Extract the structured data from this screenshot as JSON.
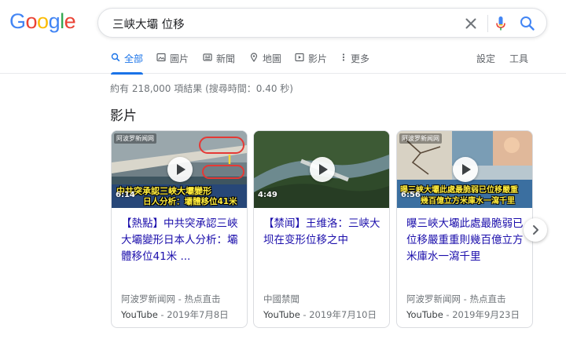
{
  "logo": {
    "letters": [
      "G",
      "o",
      "o",
      "g",
      "l",
      "e"
    ],
    "colors": [
      "#4285f4",
      "#ea4335",
      "#fbbc05",
      "#4285f4",
      "#34a853",
      "#ea4335"
    ]
  },
  "search": {
    "query": "三峡大壩 位移"
  },
  "tabs": [
    {
      "label": "全部",
      "icon": "search-icon",
      "active": true
    },
    {
      "label": "圖片",
      "icon": "image-icon",
      "active": false
    },
    {
      "label": "新聞",
      "icon": "news-icon",
      "active": false
    },
    {
      "label": "地圖",
      "icon": "map-pin-icon",
      "active": false
    },
    {
      "label": "影片",
      "icon": "video-icon",
      "active": false
    },
    {
      "label": "更多",
      "icon": "more-vert-icon",
      "active": false
    }
  ],
  "tools": {
    "settings": "設定",
    "tools": "工具"
  },
  "stats": "約有 218,000 項結果 (搜尋時間：0.40 秒)",
  "section_title": "影片",
  "videos": [
    {
      "thumb_badge": "阿波罗新闻网",
      "thumb_caption_1": "中共突承認三峽大壩變形",
      "thumb_caption_2": "日人分析：壩體移位41米",
      "duration": "6:14",
      "title": "【熱點】中共突承認三峽大壩變形日本人分析：壩體移位41米 ...",
      "channel": "阿波罗新闻网 - 热点直击",
      "source": "YouTube",
      "date": "2019年7月8日"
    },
    {
      "duration": "4:49",
      "title": "【禁闻】王维洛：三峡大坝在变形位移之中",
      "channel": "中國禁聞",
      "source": "YouTube",
      "date": "2019年7月10日"
    },
    {
      "thumb_badge": "阿波罗新闻网",
      "thumb_caption_1": "曝三峽大壩此處最脆弱已位移嚴重",
      "thumb_caption_2": "幾百億立方米庫水一瀉千里",
      "duration": "6:56",
      "title": "曝三峽大壩此處最脆弱已位移嚴重重則幾百億立方米庫水一瀉千里",
      "channel": "阿波罗新闻网 - 热点直击",
      "source": "YouTube",
      "date": "2019年9月23日"
    }
  ],
  "colors": {
    "accent": "#1a73e8",
    "link": "#1a0dab",
    "meta": "#70757a"
  }
}
